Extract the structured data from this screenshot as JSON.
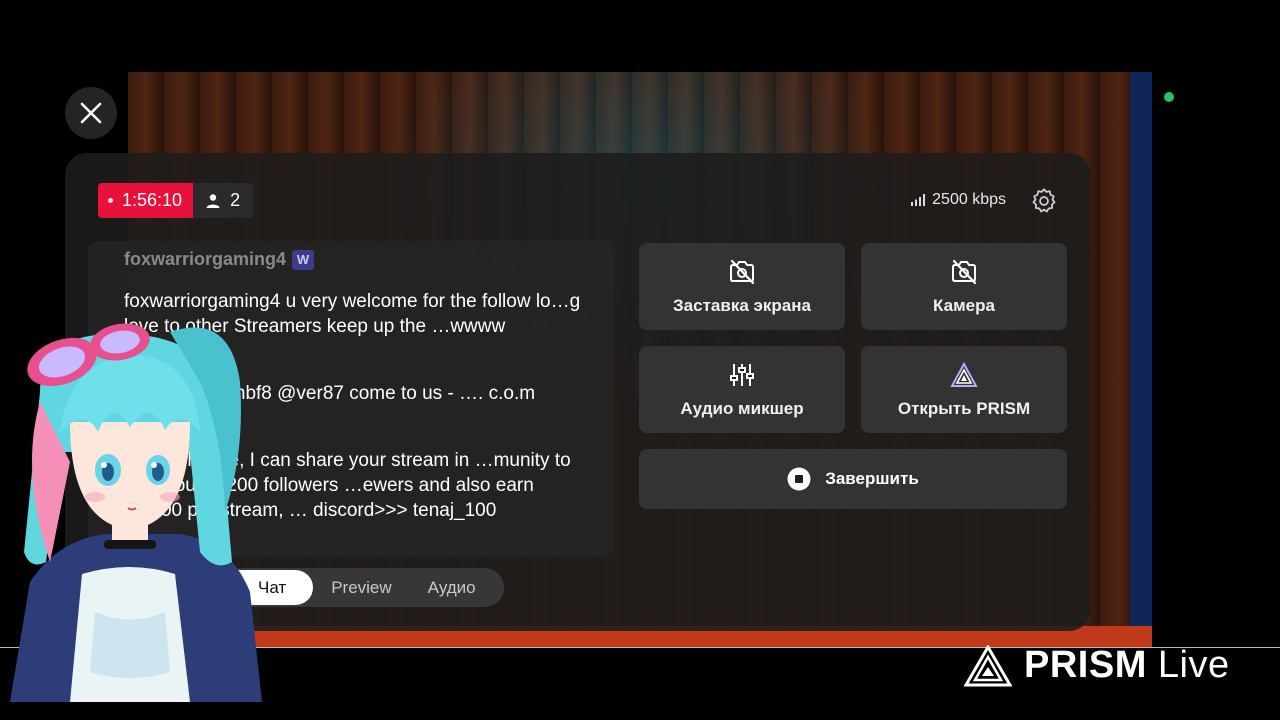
{
  "stream": {
    "duration": "1:56:10",
    "viewers": "2",
    "bitrate": "2500 kbps"
  },
  "chat": {
    "header_user": "foxwarriorgaming4",
    "badge": "W",
    "messages": [
      "foxwarriorgaming4 u very welcome for the follow lo…g love to other Streamers keep up the …wwww",
      "…ionm1spv1nbf8 @ver87 come to us - …. c.o.m FjltjzEDM",
      "… Hey homie, I can share your stream in …munity to help you hit 200 followers …ewers and also earn $1,500 per stream, … discord>>> tenaj_100"
    ]
  },
  "tabs": [
    {
      "label": "Чат",
      "active": true
    },
    {
      "label": "Preview",
      "active": false
    },
    {
      "label": "Аудио",
      "active": false
    }
  ],
  "controls": {
    "screen_saver": "Заставка экрана",
    "camera": "Камера",
    "audio_mixer": "Аудио микшер",
    "open_prism": "Открыть PRISM",
    "end": "Завершить"
  },
  "brand": {
    "name_bold": "PRISM",
    "name_light": "Live"
  },
  "colors": {
    "live_red": "#e8113a",
    "status_green": "#22c55e"
  }
}
